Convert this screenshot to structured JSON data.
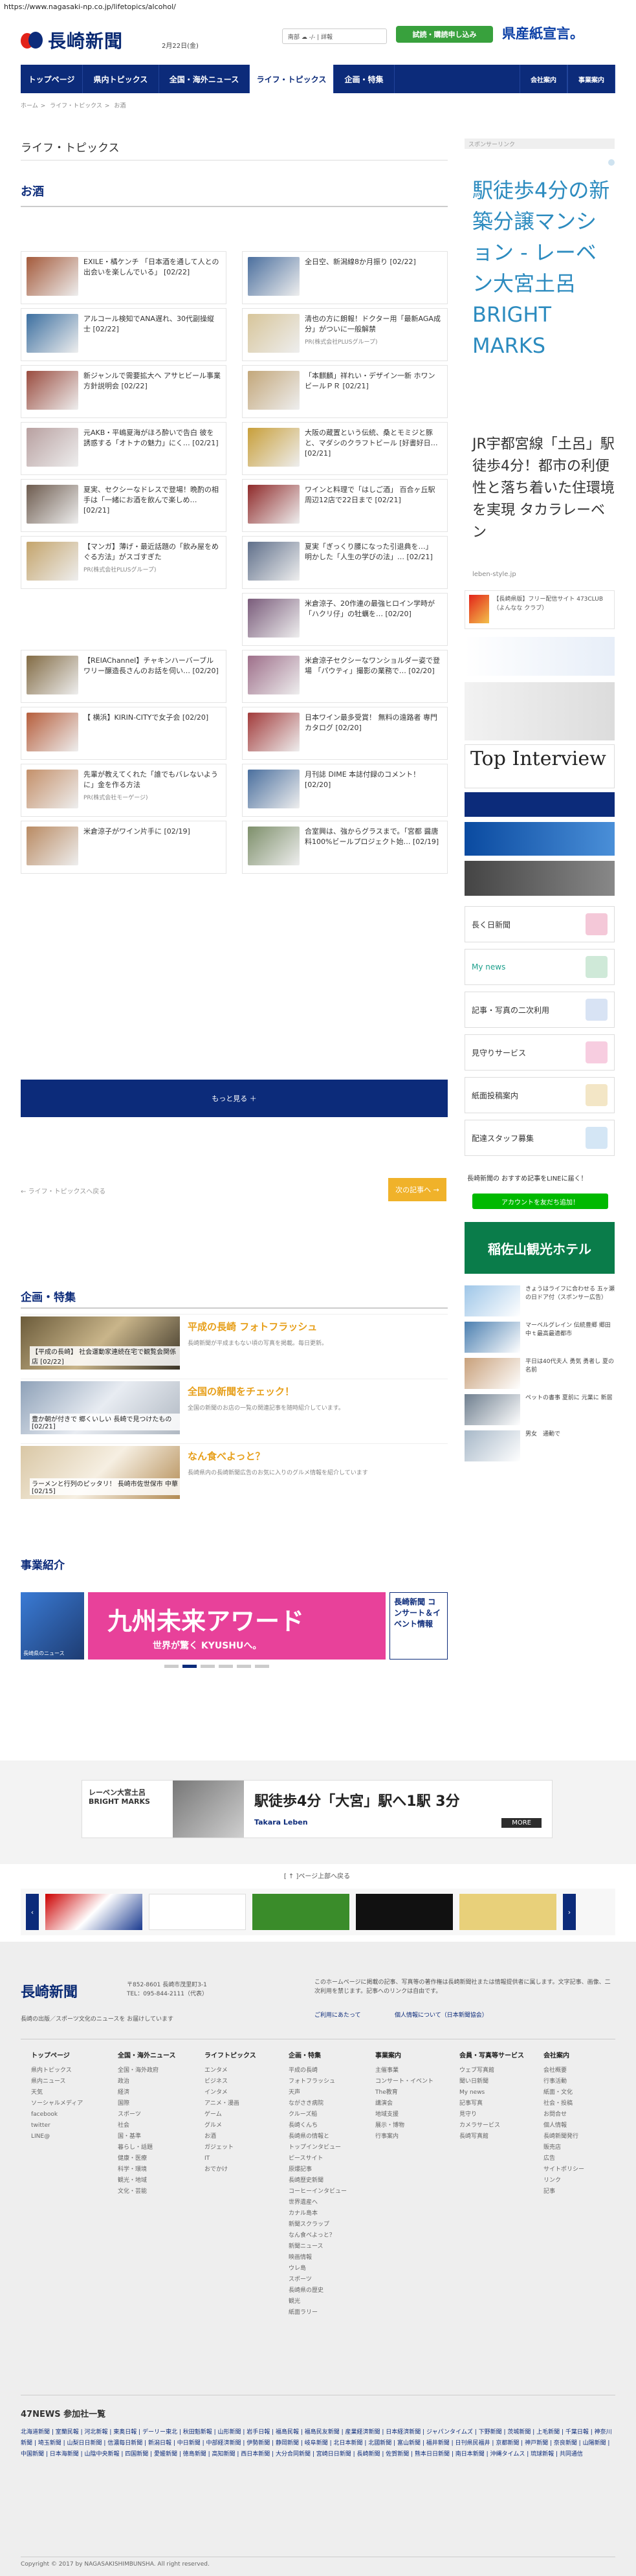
{
  "url": "https://www.nagasaki-np.co.jp/lifetopics/alcohol/",
  "header": {
    "logo_text": "長崎新聞",
    "date": "2月22日(金)",
    "weather": "南部 ☁ -/- | 詳報",
    "trial_button": "試読・購読申し込み",
    "slogan": "県産紙宣言。"
  },
  "nav": {
    "items": [
      "トップページ",
      "県内トピックス",
      "全国・海外ニュース",
      "ライフ・トピックス",
      "企画・特集"
    ],
    "active_index": 3,
    "right": [
      "会社案内",
      "事業案内"
    ]
  },
  "breadcrumb": [
    "ホーム",
    "ライフ・トピックス",
    "お酒"
  ],
  "section_title": "ライフ・トピックス",
  "category_title": "お酒",
  "articles": [
    {
      "text": "EXILE・橘ケンチ 「日本酒を通して人との出会いを楽しんでいる」 [02/22]",
      "meta": ""
    },
    {
      "text": "全日空、新潟線8か月振り [02/22]",
      "meta": ""
    },
    {
      "text": "アルコール検知でANA遅れ、30代副操縦士 [02/22]",
      "meta": ""
    },
    {
      "text": "清也の方に朗報！ドクター用「最新AGA成分」がついに一般解禁",
      "meta": "PR(株式会社PLUSグループ)"
    },
    {
      "text": "新ジャンルで需要拡大へ アサヒビール事業方針説明会 [02/22]",
      "meta": ""
    },
    {
      "text": "「本麒麟」祥れい・デザイン一新 ホワンビールＰＲ [02/21]",
      "meta": ""
    },
    {
      "text": "元AKB・平嶋夏海がほろ酔いで告白 彼を誘惑する「オトナの魅力」にく… [02/21]",
      "meta": ""
    },
    {
      "text": "大阪の蔵置という伝統、桑とモミジと豚と、マダシのクラフトビール [好書好日… [02/21]",
      "meta": ""
    },
    {
      "text": "夏実、セクシーなドレスで登場！晩酌の相手は「一緒にお酒を飲んで楽しめ… [02/21]",
      "meta": ""
    },
    {
      "text": "ワインと料理で「はしご酒」 百合ヶ丘駅周辺12店で22日まで [02/21]",
      "meta": ""
    },
    {
      "text": "【マンガ】薄げ・最近話題の「飲み屋をめぐる方法」がスゴすぎた",
      "meta": "PR(株式会社PLUSグループ)"
    },
    {
      "text": "夏実「ぎっくり腰になった引退典を…」 明かした「人生の学びの法」… [02/21]",
      "meta": ""
    },
    {
      "text": "米倉涼子、20作連の最強ヒロイン学時が「ハクリ仔」の牡蠣を… [02/20]",
      "meta": ""
    },
    {
      "text": "【REIAChannel】チャキンハーバーブルワリー醸造長さんのお話を伺い… [02/20]",
      "meta": ""
    },
    {
      "text": "米倉涼子セクシーなワンショルダー姿で登場 「パウティ」撮影の業務で… [02/20]",
      "meta": ""
    },
    {
      "text": "【 横浜】KIRIN-CITYで女子会 [02/20]",
      "meta": ""
    },
    {
      "text": "日本ワイン最多受賞！ 無料の遠路者 専門カタログ [02/20]",
      "meta": ""
    },
    {
      "text": "先輩が教えてくれた「誰でもバレないように」金を作る方法",
      "meta": "PR(株式会社モーゲージ)"
    },
    {
      "text": "月刊誌 DIME 本誌付録のコメント！ [02/20]",
      "meta": ""
    },
    {
      "text": "米倉涼子がワイン片手に [02/19]",
      "meta": ""
    },
    {
      "text": "合室興は、強からグラスまで。「宮都 醤唐料100%ビールプロジェクト始… [02/19]",
      "meta": ""
    }
  ],
  "more_button": "もっと見る ＋",
  "back_link": "← ライフ・トピックスへ戻る",
  "next_button": "次の記事へ →",
  "features_title": "企画・特集",
  "features": [
    {
      "image_caption": "【平成の長崎】 社会運動家連続在宅で観覧会関係店 [02/22]",
      "title": "平成の長崎 フォトフラッシュ",
      "desc": "長崎新聞が平成まもない頃の写真を掲載。毎日更新。"
    },
    {
      "image_caption": "豊か朝が付きで 郷くいしい 長崎で見つけたもの [02/21]",
      "title": "全国の新聞をチェック！",
      "desc": "全国の新聞のお店の一覧の関連記事を随時紹介しています。"
    },
    {
      "image_caption": "ラーメンと行列のピッタリ！ 長崎市佐世保市 中華 [02/15]",
      "title": "なん食べよっと？",
      "desc": "長崎県内の長崎新聞広告のお気に入りのグルメ情報を紹介しています"
    }
  ],
  "events_title": "事業紹介",
  "events_banner": {
    "main": "九州未来アワード",
    "sub": "世界が驚く KYUSHUへ。",
    "right_label": "長崎新聞 コンサート＆イベント情報",
    "left_label": "長崎県のニュース"
  },
  "sidebar": {
    "sponsor_label": "スポンサーリンク",
    "ad_headline": "駅徒歩4分の新築分譲マンション - レーベン大宮土呂 BRIGHT MARKS",
    "ad_body": "JR宇都宮線「土呂」駅徒歩4分！都市の利便性と落ち着いた住環境を実現 タカラレーベン",
    "ad_url": "leben-style.jp",
    "promo_caption": "【長崎県版】フリー配信サイト 473CLUB（よんなな クラブ）",
    "boxes": [
      "長く日新聞",
      "My news",
      "記事・写真の二次利用",
      "見守りサービス",
      "紙面投稿案内",
      "配達スタッフ募集"
    ],
    "line_text": "長崎新聞の おすすめ記事をLINEに届く！",
    "line_button": "アカウントを友だち追加！",
    "hotel": "稲佐山観光ホテル",
    "small_items": [
      "きょうはライフに合わせる 五ヶ瀬の日ドア付（スポンサー広告）",
      "マーベルグレイン 伝統豊郷 郷田中ｔ最高最適都市",
      "平日は40代夫人 勇気 勇者し 夏の名前",
      "ペットの書事 夏前に 元業に 新居",
      "男女　通動で"
    ]
  },
  "footer_ad": {
    "brand": "レーベン大宮土呂 BRIGHT MARKS",
    "text": "駅徒歩4分「大宮」駅へ1駅 3分",
    "company": "Takara Leben",
    "more": "MORE"
  },
  "carousel_label": "[ ↑ ]ページ上部へ戻る",
  "footer": {
    "logo": "長崎新聞",
    "address": "〒852-8601 長崎市茂里町3-1",
    "tel": "TEL：095-844-2111（代表）",
    "note": "長崎の出版／スポーツ文化のニュースを お届けしています",
    "right_text": "このホームページに掲載の記事、写真等の著作権は長崎新聞社または情報提供者に属します。文字記事、画像、二次利用を禁じます。記事へのリンクは自由です。",
    "privacy": "ご利用にあたって",
    "terms": "個人情報について（日本新聞協会）",
    "columns": [
      {
        "title": "トップページ",
        "items": [
          "県内トピックス",
          "県内ニュース",
          "天気",
          "ソーシャルメディア",
          "facebook",
          "twitter",
          "LINE@"
        ]
      },
      {
        "title": "全国・海外ニュース",
        "items": [
          "全国・海外政府",
          "政治",
          "経済",
          "国際",
          "スポーツ",
          "社会",
          "国・基準",
          "暮らし・話題",
          "健康・医療",
          "科学・環境",
          "観光・地域",
          "文化・芸能"
        ]
      },
      {
        "title": "ライフトピックス",
        "items": [
          "エンタメ",
          "ビジネス",
          "インタメ",
          "アニメ・漫画",
          "ゲーム",
          "グルメ",
          "お酒",
          "ガジェット",
          "IT",
          "おでかけ"
        ]
      },
      {
        "title": "企画・特集",
        "items": [
          "平成の長崎",
          "フォトフラッシュ",
          "天声",
          "ながさき病院",
          "クルーズ船",
          "長崎くんち",
          "長崎県の情報と",
          "トップインタビュー",
          "ピースサイト",
          "原爆記事",
          "長崎歴史新聞",
          "コーヒーインタビュー",
          "世界遺産へ",
          "カナル島本",
          "新聞スクラップ",
          "なん食べよっと？",
          "新聞ニュース",
          "映画情報",
          "ウレ島",
          "スポーツ",
          "長崎県の歴史",
          "観光",
          "紙面ラリー"
        ]
      },
      {
        "title": "事業案内",
        "items": [
          "主催事業",
          "コンサート・イベント",
          "The教育",
          "講演会",
          "地域支援",
          "展示・博物",
          "行事案内"
        ]
      },
      {
        "title": "会員・写真等サービス",
        "items": [
          "ウェブ写真館",
          "聞い日新聞",
          "My news",
          "記事写真",
          "見守り",
          "カメラサービス",
          "長崎写真館"
        ]
      },
      {
        "title": "会社案内",
        "items": [
          "会社概要",
          "行事活動",
          "紙面・文化",
          "社会・投稿",
          "お問合せ",
          "個人情報",
          "長崎新聞発行",
          "販売店",
          "広告",
          "サイトポリシー",
          "リンク",
          "記事"
        ]
      }
    ]
  },
  "network": {
    "title": "47NEWS 参加社一覧",
    "text": "北海道新聞 | 室蘭民報 | 河北新報 | 東奥日報 | デーリー東北 | 秋田魁新報 | 山形新聞 | 岩手日報 | 福島民報 | 福島民友新聞 | 産業経済新聞 | 日本経済新聞 | ジャパンタイムズ | 下野新聞 | 茨城新聞 | 上毛新聞 | 千葉日報 | 神奈川新聞 | 埼玉新聞 | 山梨日日新聞 | 信濃毎日新聞 | 新潟日報 | 中日新聞 | 中部経済新聞 | 伊勢新聞 | 静岡新聞 | 岐阜新聞 | 北日本新聞 | 北國新聞 | 富山新聞 | 福井新聞 | 日刊県民福井 | 京都新聞 | 神戸新聞 | 奈良新聞 | 山陽新聞 | 中国新聞 | 日本海新聞 | 山陰中央新報 | 四国新聞 | 愛媛新聞 | 徳島新聞 | 高知新聞 | 西日本新聞 | 大分合同新聞 | 宮崎日日新聞 | 長崎新聞 | 佐賀新聞 | 熊本日日新聞 | 南日本新聞 | 沖縄タイムス | 琉球新報 | 共同通信"
  },
  "copyright": "Copyright © 2017 by NAGASAKISHIMBUNSHA. All right reserved.",
  "colors": {
    "navy": "#0c2b7a",
    "accent": "#e79f1a",
    "green": "#38a13d"
  }
}
